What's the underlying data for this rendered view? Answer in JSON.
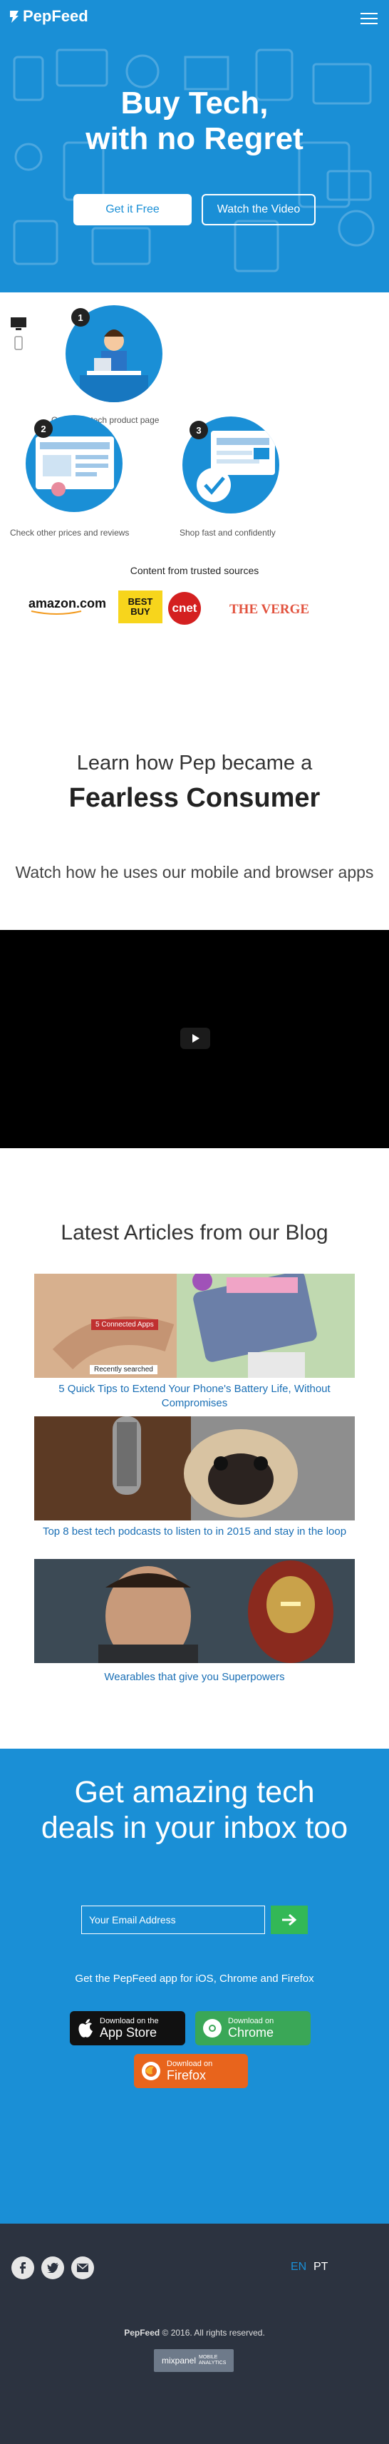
{
  "header": {
    "brand": "PepFeed"
  },
  "hero": {
    "title_line1": "Buy Tech,",
    "title_line2": "with no Regret",
    "cta_primary": "Get it Free",
    "cta_secondary": "Watch the Video"
  },
  "steps": [
    {
      "number": "1",
      "label": "Open any tech product page"
    },
    {
      "number": "2",
      "label": "Check other prices and reviews"
    },
    {
      "number": "3",
      "label": "Shop fast and confidently"
    }
  ],
  "trusted": {
    "caption": "Content from trusted sources",
    "brands": [
      "amazon.com",
      "BEST BUY",
      "cnet",
      "THE VERGE"
    ]
  },
  "promo": {
    "learn": "Learn how Pep became a",
    "fearless": "Fearless Consumer",
    "watch": "Watch how he uses our mobile and browser apps"
  },
  "blog": {
    "title": "Latest Articles from our Blog",
    "articles": [
      {
        "title": "5 Quick Tips to Extend Your Phone's Battery Life, Without Compromises",
        "img_text_1": "5 Connected Apps",
        "img_text_2": "Recently searched"
      },
      {
        "title": "Top 8 best tech podcasts to listen to in 2015 and stay in the loop"
      },
      {
        "title": "Wearables that give you Superpowers"
      }
    ]
  },
  "newsletter": {
    "title_line1": "Get amazing tech",
    "title_line2": "deals in your inbox too",
    "placeholder": "Your Email Address",
    "apps_caption": "Get the PepFeed app for iOS, Chrome and Firefox",
    "appstore_small": "Download on the",
    "appstore_big": "App Store",
    "chrome_small": "Download on",
    "chrome_big": "Chrome",
    "firefox_small": "Download on",
    "firefox_big": "Firefox"
  },
  "footer": {
    "lang_en": "EN",
    "lang_pt": "PT",
    "copyright_brand": "PepFeed",
    "copyright_rest": " © 2016. All rights reserved.",
    "mixpanel": "mixpanel",
    "mixpanel_sub": "MOBILE ANALYTICS"
  },
  "colors": {
    "primary": "#1a8fd6",
    "green": "#33b856",
    "footer": "#2c3340",
    "firefox": "#e8641c",
    "chrome": "#3aa757"
  }
}
